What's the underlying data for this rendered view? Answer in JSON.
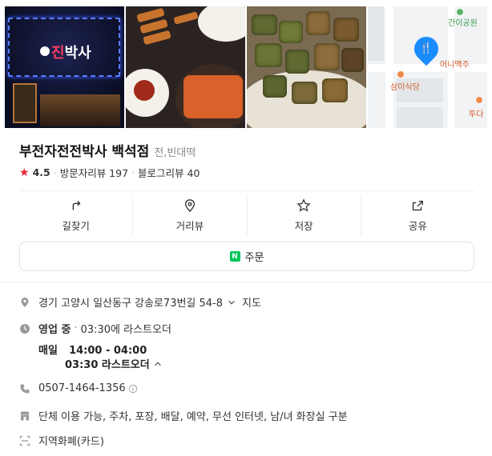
{
  "place": {
    "name": "부전자전전박사 백석점",
    "category": "전,빈대떡",
    "rating": "4.5",
    "visitor_reviews": "방문자리뷰 197",
    "blog_reviews": "블로그리뷰 40"
  },
  "photos": {
    "sign_text_red": "진",
    "sign_text_white": "박사",
    "map_labels": {
      "park": "간이공원",
      "place1": "머니맥주",
      "place2": "삼미식당",
      "place3": "투다"
    }
  },
  "actions": [
    {
      "label": "길찾기",
      "icon": "directions-icon"
    },
    {
      "label": "거리뷰",
      "icon": "street-view-icon"
    },
    {
      "label": "저장",
      "icon": "star-icon"
    },
    {
      "label": "공유",
      "icon": "share-icon"
    }
  ],
  "order": {
    "badge": "N",
    "label": "주문"
  },
  "info": {
    "address": "경기 고양시 일산동구 강송로73번길 54-8",
    "map_link": "지도",
    "status": "영업 중",
    "last_order_summary": "03:30에 라스트오더",
    "hours_day": "매일",
    "hours_time": "14:00 - 04:00",
    "last_order_detail": "03:30 라스트오더",
    "phone": "0507-1464-1356",
    "amenities": "단체 이용 가능, 주차, 포장, 배달, 예약, 무선 인터넷, 남/녀 화장실 구분",
    "payment": "지역화폐(카드)"
  },
  "colors": {
    "star": "#e6263a",
    "naver_green": "#03c75a",
    "map_pin": "#1a8cff"
  }
}
